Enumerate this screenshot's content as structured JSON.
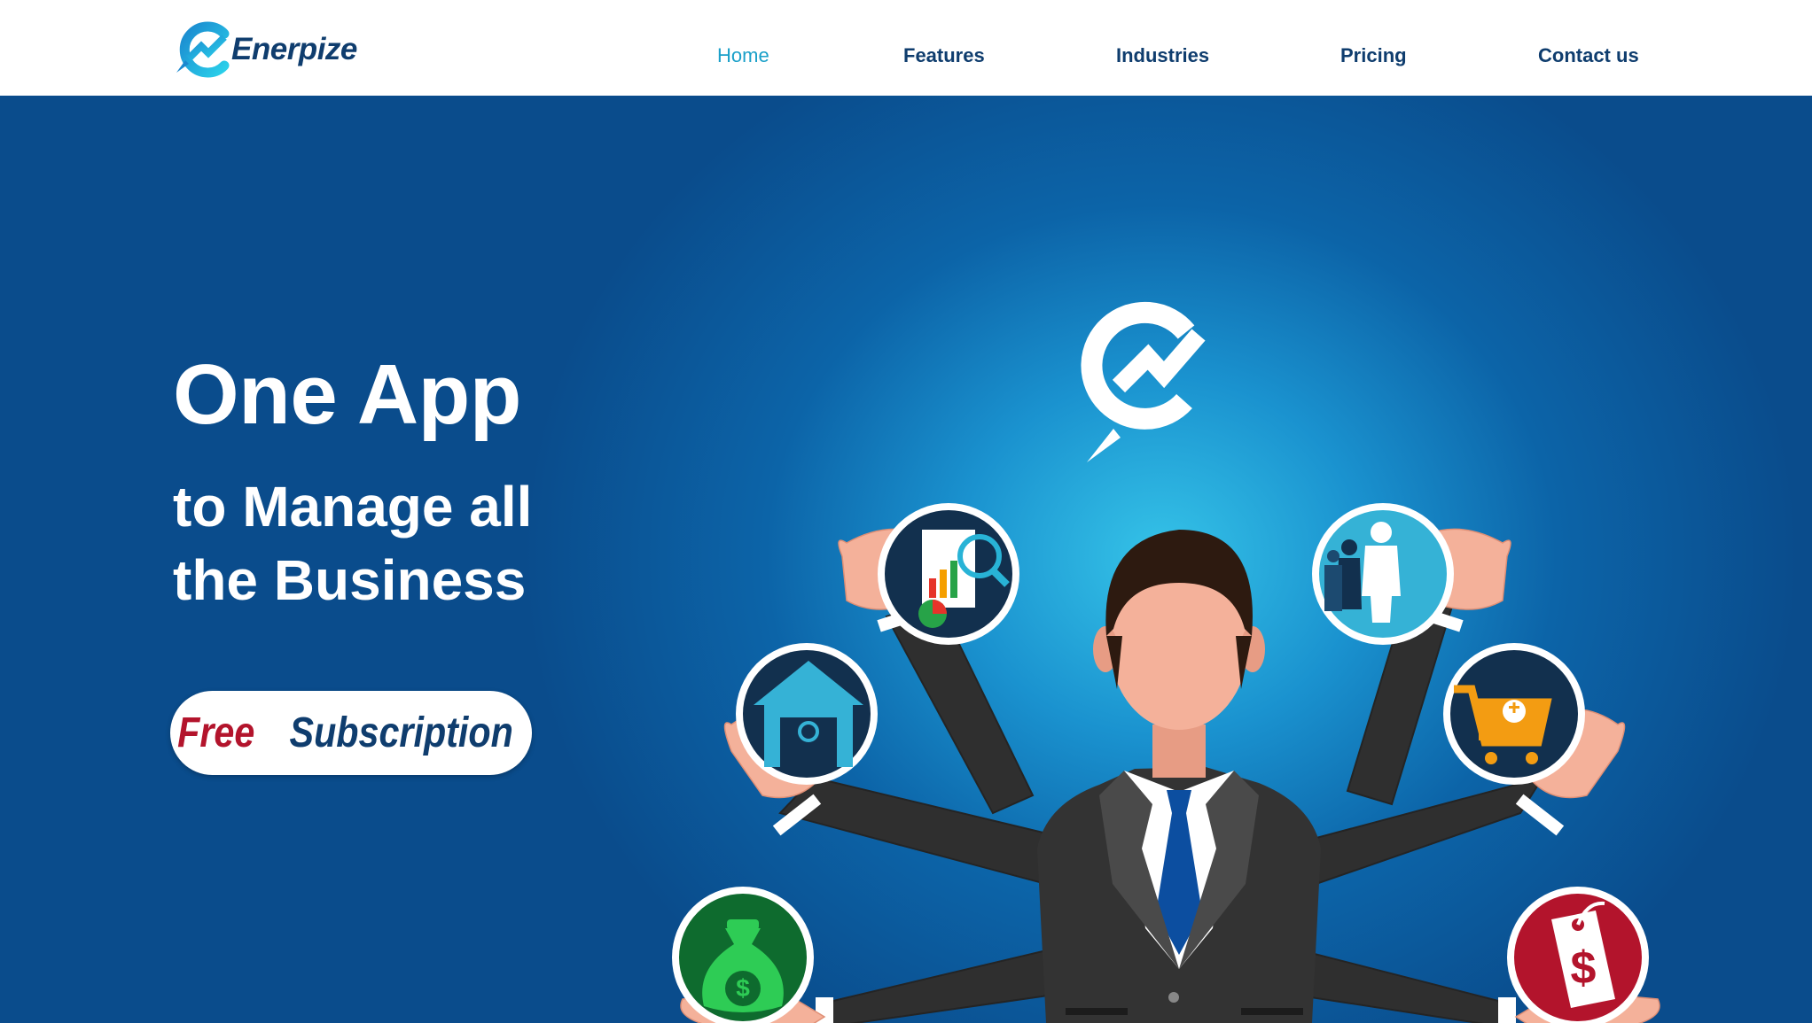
{
  "brand": {
    "name": "Enerpize",
    "color_primary": "#0f3d6e",
    "color_accent": "#1aa0c9"
  },
  "nav": {
    "items": [
      {
        "label": "Home",
        "active": true
      },
      {
        "label": "Features",
        "active": false
      },
      {
        "label": "Industries",
        "active": false
      },
      {
        "label": "Pricing",
        "active": false
      },
      {
        "label": "Contact us",
        "active": false
      }
    ]
  },
  "hero": {
    "headline": "One App",
    "subline_1": "to Manage all",
    "subline_2": "the Business",
    "cta": {
      "word_1": "Free",
      "word_2": "Subscription",
      "color_1": "#b3142c",
      "color_2": "#0f3d6e"
    },
    "illustration": {
      "figure": "businessman-with-six-arms",
      "icons": [
        "reports-icon",
        "employees-icon",
        "warehouse-icon",
        "shopping-cart-icon",
        "money-bag-icon",
        "price-tag-icon"
      ]
    }
  }
}
